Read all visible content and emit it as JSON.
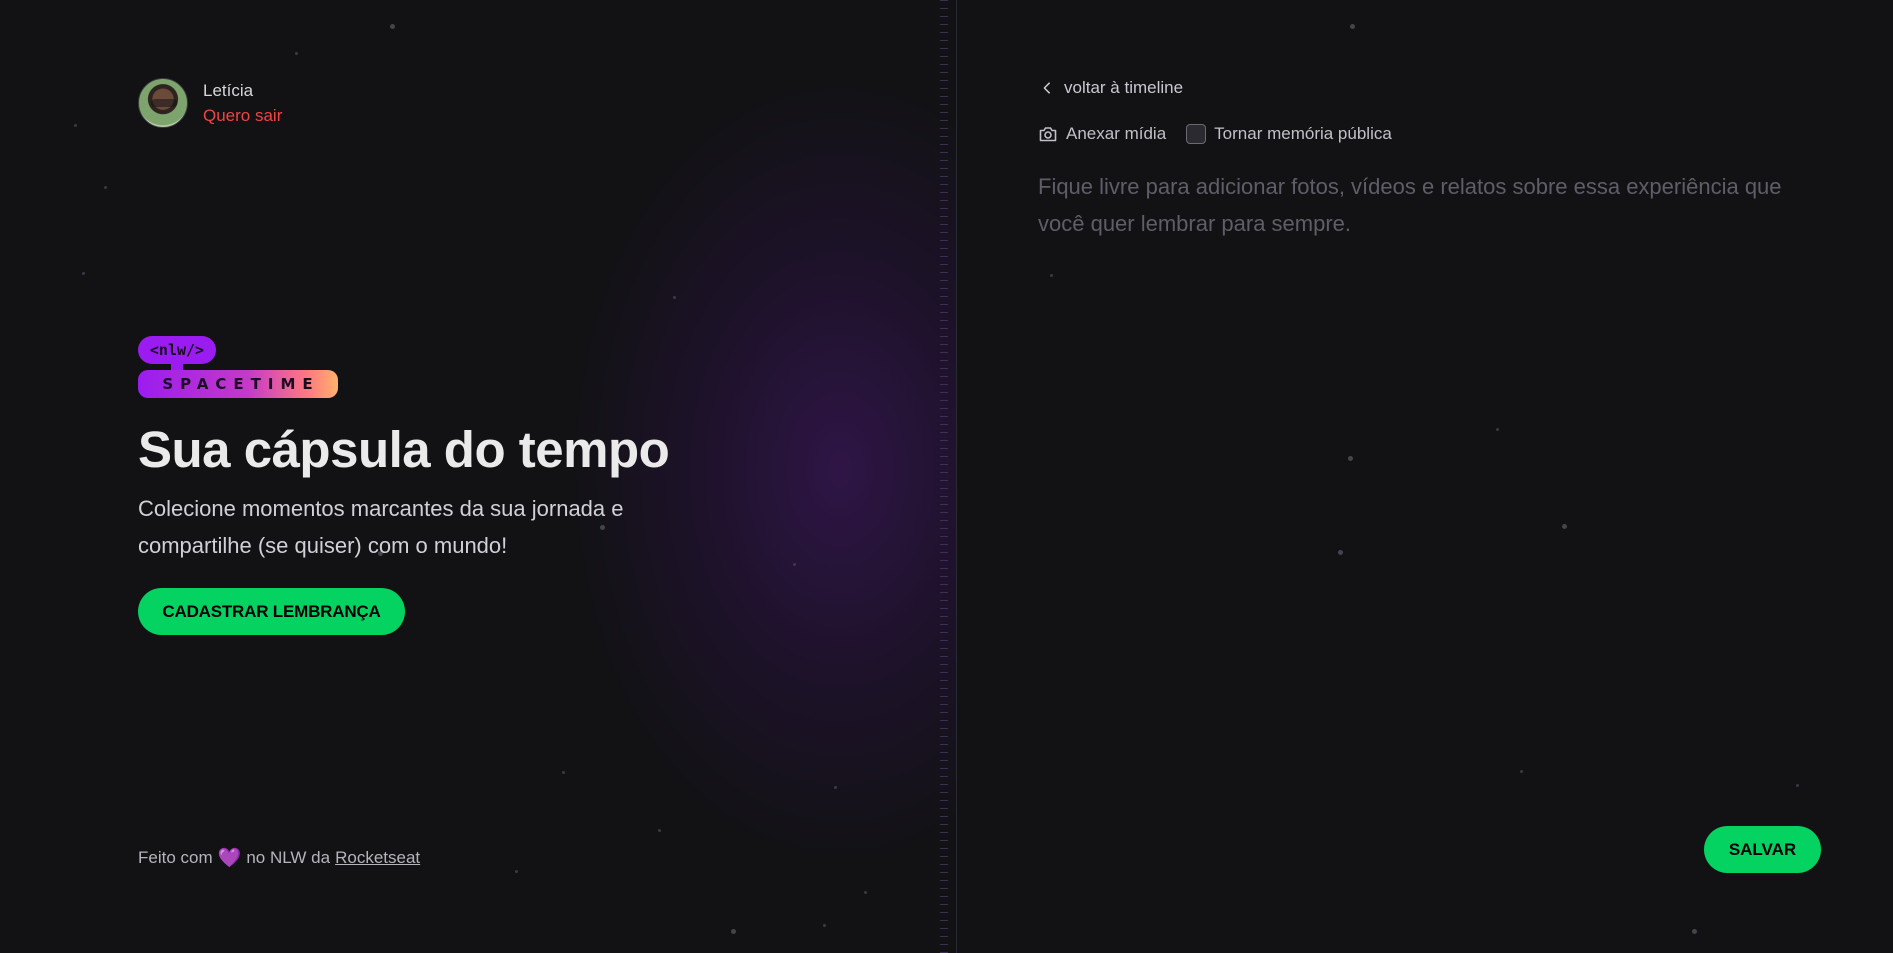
{
  "user": {
    "name": "Letícia",
    "logout_label": "Quero sair"
  },
  "logo": {
    "tag": "<nlw/>",
    "brand": "SPACETIME"
  },
  "hero": {
    "title": "Sua cápsula do tempo",
    "description": "Colecione momentos marcantes da sua jornada e compartilhe (se quiser) com o mundo!",
    "cta_label": "CADASTRAR LEMBRANÇA"
  },
  "footer": {
    "prefix": "Feito com",
    "heart": "💜",
    "middle": "no NLW da",
    "link_label": "Rocketseat"
  },
  "form": {
    "back_label": "voltar à timeline",
    "attach_label": "Anexar mídia",
    "public_label": "Tornar memória pública",
    "public_checked": false,
    "content_value": "",
    "content_placeholder": "Fique livre para adicionar fotos, vídeos e relatos sobre essa experiência que você quer lembrar para sempre.",
    "save_label": "SALVAR"
  },
  "colors": {
    "accent_green": "#04D361",
    "logout_red": "#EF4444",
    "background": "#121215",
    "brand_purple": "#9b1cf0"
  }
}
